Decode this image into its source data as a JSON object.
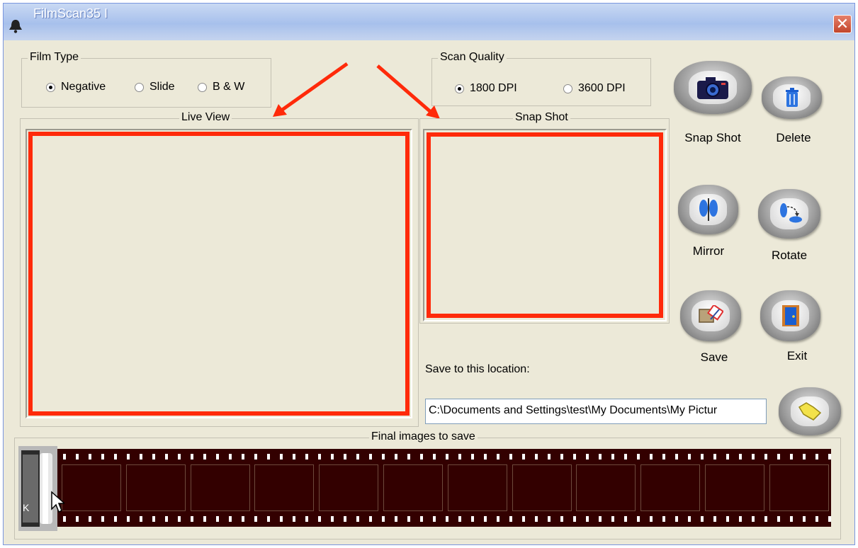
{
  "window": {
    "title": "FilmScan35 I",
    "close_glyph": "✕"
  },
  "film_type": {
    "label": "Film Type",
    "options": [
      "Negative",
      "Slide",
      "B & W"
    ],
    "selected": "Negative"
  },
  "scan_quality": {
    "label": "Scan Quality",
    "options": [
      "1800 DPI",
      "3600 DPI"
    ],
    "selected": "1800 DPI"
  },
  "live_view": {
    "label": "Live  View"
  },
  "snap_shot_panel": {
    "label": "Snap Shot"
  },
  "buttons": {
    "snap_shot": "Snap Shot",
    "delete": "Delete",
    "mirror": "Mirror",
    "rotate": "Rotate",
    "save": "Save",
    "exit": "Exit"
  },
  "save_location": {
    "label": "Save to this location:",
    "value": "C:\\Documents and Settings\\test\\My Documents\\My Pictur"
  },
  "final_images": {
    "label": "Final images to save",
    "frame_count": 12
  },
  "icons": {
    "app": "bell-icon",
    "snap": "camera-icon",
    "delete": "trash-icon",
    "mirror": "mirror-icon",
    "rotate": "rotate-icon",
    "save": "save-icon",
    "exit": "door-icon",
    "browse": "folder-icon",
    "canister": "film-canister-icon",
    "cursor": "mouse-cursor-icon"
  },
  "colors": {
    "frame_highlight": "#ff2a0a",
    "filmstrip": "#330000",
    "window_bg": "#ece9d8"
  }
}
